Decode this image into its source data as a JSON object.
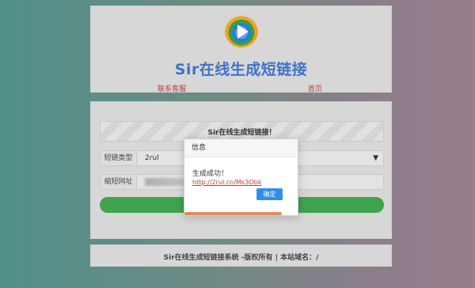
{
  "header": {
    "title": "Sir在线生成短链接",
    "links": {
      "service": "联系客服",
      "home": "首页"
    },
    "logo_icon": "play-logo-icon"
  },
  "main": {
    "banner": "Sir在线生成短链接！",
    "form": {
      "type_label": "短链类型",
      "type_value": "2rul",
      "url_label": "缩短网址"
    }
  },
  "modal": {
    "title": "信息",
    "message": "生成成功！",
    "result_link": "http://2rul.cn/Mk3Obk",
    "confirm_label": "确定",
    "progress_fraction": 0.85
  },
  "footer": {
    "text": "Sir在线生成短链接系统 -版权所有 | 本站域名：/"
  },
  "colors": {
    "accent_blue": "#3f73c9",
    "primary_button": "#2f8ee8",
    "success_green": "#3fa34d",
    "link_red": "#c23a3a",
    "progress_orange": "#e08a5e"
  }
}
